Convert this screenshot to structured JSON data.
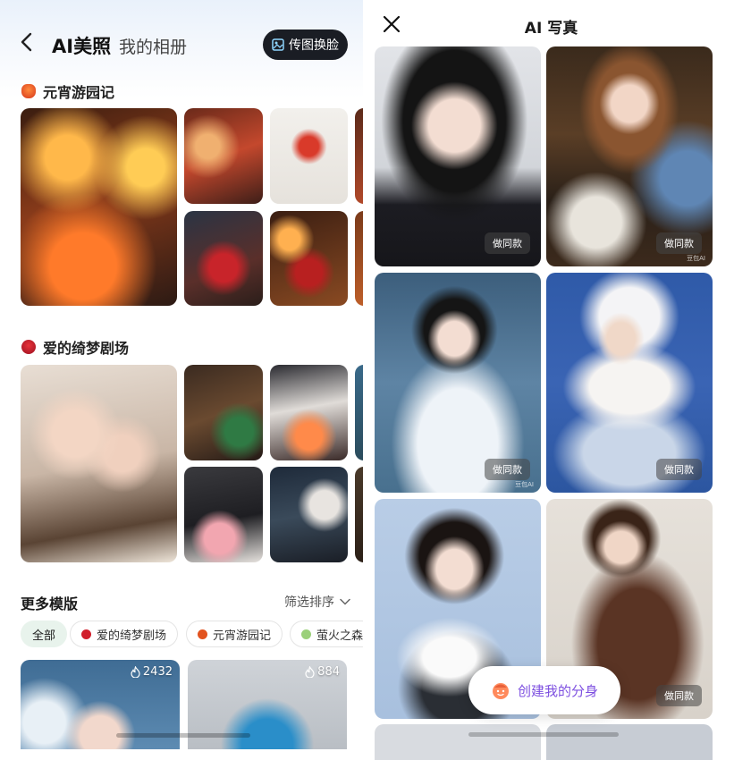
{
  "left": {
    "back_icon": "chevron-left-icon",
    "tab_active": "AI美照",
    "tab_inactive": "我的相册",
    "swap_button": {
      "label": "传图换脸",
      "icon": "image-swap-icon"
    },
    "section1": {
      "title": "元宵游园记",
      "icon": "lantern-icon"
    },
    "section2": {
      "title": "爱的绮梦剧场",
      "icon": "rose-icon"
    },
    "more": {
      "title": "更多模版",
      "sort_label": "筛选排序",
      "sort_icon": "chevron-down-icon"
    },
    "chips": [
      {
        "label": "全部",
        "icon": ""
      },
      {
        "label": "爱的绮梦剧场",
        "icon": "rose-icon"
      },
      {
        "label": "元宵游园记",
        "icon": "lantern-icon"
      },
      {
        "label": "萤火之森",
        "icon": "firefly-icon"
      }
    ],
    "cards": [
      {
        "count": "2432",
        "icon": "flame-icon"
      },
      {
        "count": "884",
        "icon": "flame-icon"
      }
    ]
  },
  "right": {
    "close_icon": "close-icon",
    "title": "AI 写真",
    "same_style_label": "做同款",
    "watermark": "豆包AI",
    "create_button": {
      "label": "创建我的分身",
      "icon": "avatar-face-icon"
    }
  },
  "colors": {
    "accent_dark": "#1a1d24",
    "create_text": "#7d4fe0",
    "chip_active_bg": "#e8f3ec"
  }
}
